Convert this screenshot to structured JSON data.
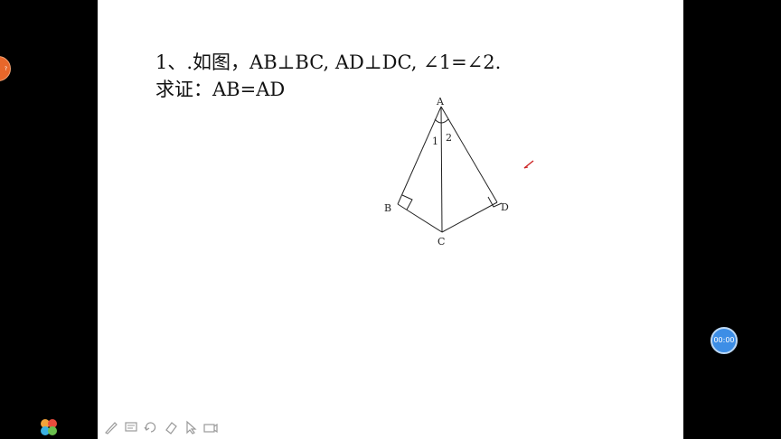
{
  "problem": {
    "line1": "1、.如图，AB⊥BC, AD⊥DC, ∠1=∠2.",
    "line2": "求证：AB=AD"
  },
  "figure": {
    "label_a": "A",
    "label_b": "B",
    "label_c": "C",
    "label_d": "D",
    "angle_1": "1",
    "angle_2": "2"
  },
  "timer": {
    "text": "00:00"
  },
  "side_badge": {
    "text": "?"
  },
  "toolbar": {
    "tools": [
      "pen-icon",
      "comment-icon",
      "undo-icon",
      "eraser-icon",
      "pointer-icon",
      "camera-icon"
    ]
  },
  "colors": {
    "badge": "#e8672a",
    "timer": "#3d8ee6",
    "cursor": "#cc2222"
  }
}
